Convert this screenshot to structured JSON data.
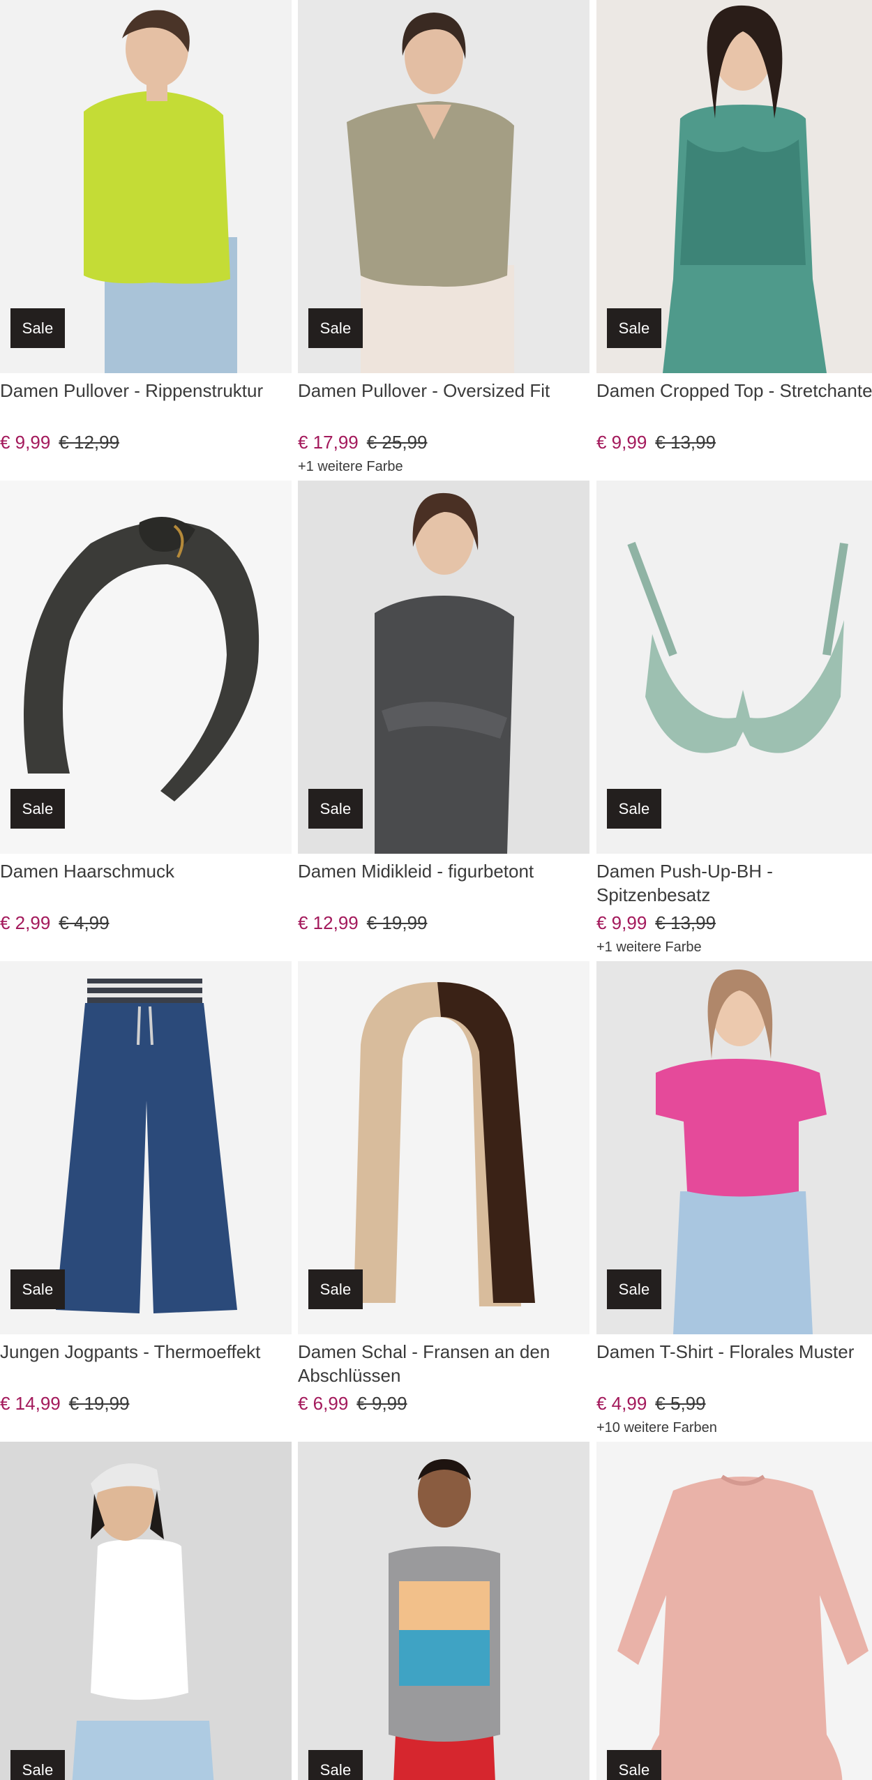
{
  "products": [
    {
      "title": "Damen Pullover - Rippenstruktur",
      "badge": "Sale",
      "price": "€ 9,99",
      "old_price": "€ 12,99",
      "more_colors": "",
      "image": "lime-ribbed-sweater"
    },
    {
      "title": "Damen Pullover - Oversized Fit",
      "badge": "Sale",
      "price": "€ 17,99",
      "old_price": "€ 25,99",
      "more_colors": "+1 weitere Farbe",
      "image": "olive-oversized-sweater"
    },
    {
      "title": "Damen Cropped Top - Stretchanteil",
      "badge": "Sale",
      "price": "€ 9,99",
      "old_price": "€ 13,99",
      "more_colors": "",
      "image": "teal-patterned-cropped-top"
    },
    {
      "title": "Damen Haarschmuck",
      "badge": "Sale",
      "price": "€ 2,99",
      "old_price": "€ 4,99",
      "more_colors": "",
      "image": "black-knotted-headband"
    },
    {
      "title": "Damen Midikleid - figurbetont",
      "badge": "Sale",
      "price": "€ 12,99",
      "old_price": "€ 19,99",
      "more_colors": "",
      "image": "grey-glitter-midi-dress"
    },
    {
      "title": "Damen Push-Up-BH - Spitzenbesatz",
      "badge": "Sale",
      "price": "€ 9,99",
      "old_price": "€ 13,99",
      "more_colors": "+1 weitere Farbe",
      "image": "mint-lace-push-up-bra"
    },
    {
      "title": "Jungen Jogpants - Thermoeffekt",
      "badge": "Sale",
      "price": "€ 14,99",
      "old_price": "€ 19,99",
      "more_colors": "",
      "image": "dark-denim-jogpants"
    },
    {
      "title": "Damen Schal - Fransen an den Abschlüssen",
      "badge": "Sale",
      "price": "€ 6,99",
      "old_price": "€ 9,99",
      "more_colors": "",
      "image": "beige-brown-scarf"
    },
    {
      "title": "Damen T-Shirt - Florales Muster",
      "badge": "Sale",
      "price": "€ 4,99",
      "old_price": "€ 5,99",
      "more_colors": "+10 weitere Farben",
      "image": "pink-floral-tshirt"
    },
    {
      "title": "",
      "badge": "Sale",
      "price": "",
      "old_price": "",
      "more_colors": "",
      "image": "white-tank-top-bandana"
    },
    {
      "title": "",
      "badge": "Sale",
      "price": "",
      "old_price": "",
      "more_colors": "",
      "image": "grey-palm-print-tank"
    },
    {
      "title": "",
      "badge": "Sale",
      "price": "",
      "old_price": "",
      "more_colors": "",
      "image": "pink-printed-girls-dress"
    }
  ],
  "colors": {
    "sale_price": "#a3195b",
    "badge_bg": "#231f1e",
    "text": "#3a3a3a"
  }
}
